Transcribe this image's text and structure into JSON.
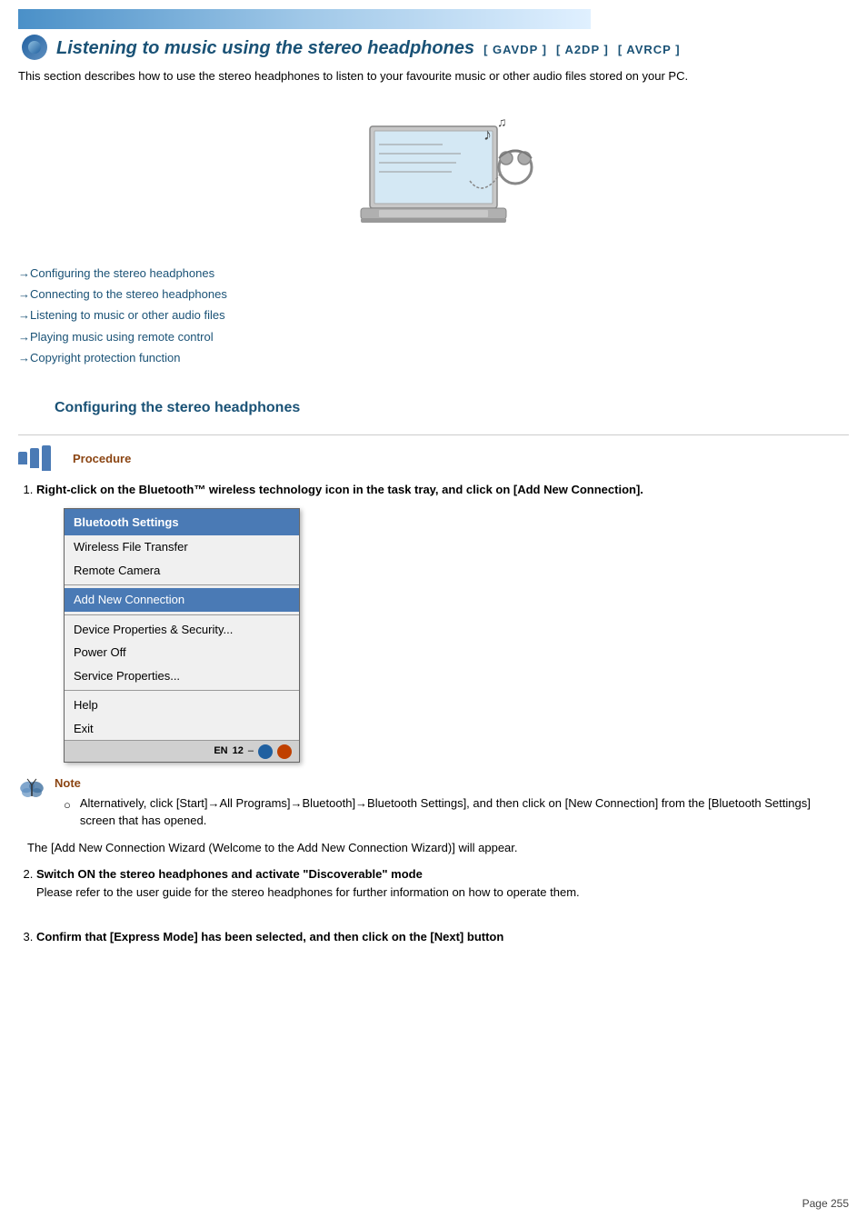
{
  "banner": {},
  "title": {
    "main": "Listening to music using the stereo headphones",
    "tag1": "[ GAVDP ]",
    "tag2": "[ A2DP ]",
    "tag3": "[ AVRCP ]"
  },
  "intro": "This section describes how to use the stereo headphones to listen to your favourite music or other audio files stored on your PC.",
  "links": [
    "→Configuring the stereo headphones",
    "→Connecting to the stereo headphones",
    "→Listening to music or other audio files",
    "→Playing music using remote control",
    "→Copyright protection function"
  ],
  "section_heading": "Configuring the stereo headphones",
  "procedure_label": "Procedure",
  "steps": [
    {
      "number": "1.",
      "bold_text": "Right-click on the Bluetooth™ wireless technology icon in the task tray, and click on [Add New Connection]."
    },
    {
      "number": "2.",
      "bold_text": "Switch ON the stereo headphones and activate \"Discoverable\" mode",
      "normal_text": "Please refer to the user guide for the stereo headphones for further information on how to operate them."
    },
    {
      "number": "3.",
      "bold_text": "Confirm that [Express Mode] has been selected, and then click on the [Next] button"
    }
  ],
  "context_menu": {
    "header": "Bluetooth Settings",
    "items": [
      "Wireless File Transfer",
      "Remote Camera"
    ],
    "highlighted": "Add New Connection",
    "section2": [
      "Device Properties & Security...",
      "Power Off",
      "Service Properties..."
    ],
    "section3": [
      "Help",
      "Exit"
    ],
    "footer_text": "EN"
  },
  "note": {
    "label": "Note",
    "text": "Alternatively, click [Start]→All Programs]→Bluetooth]→Bluetooth Settings], and then click on [New Connection] from the [Bluetooth Settings] screen that has opened."
  },
  "wizard_text": "The [Add New Connection Wizard (Welcome to the Add New Connection Wizard)] will appear.",
  "page_number": "Page 255"
}
